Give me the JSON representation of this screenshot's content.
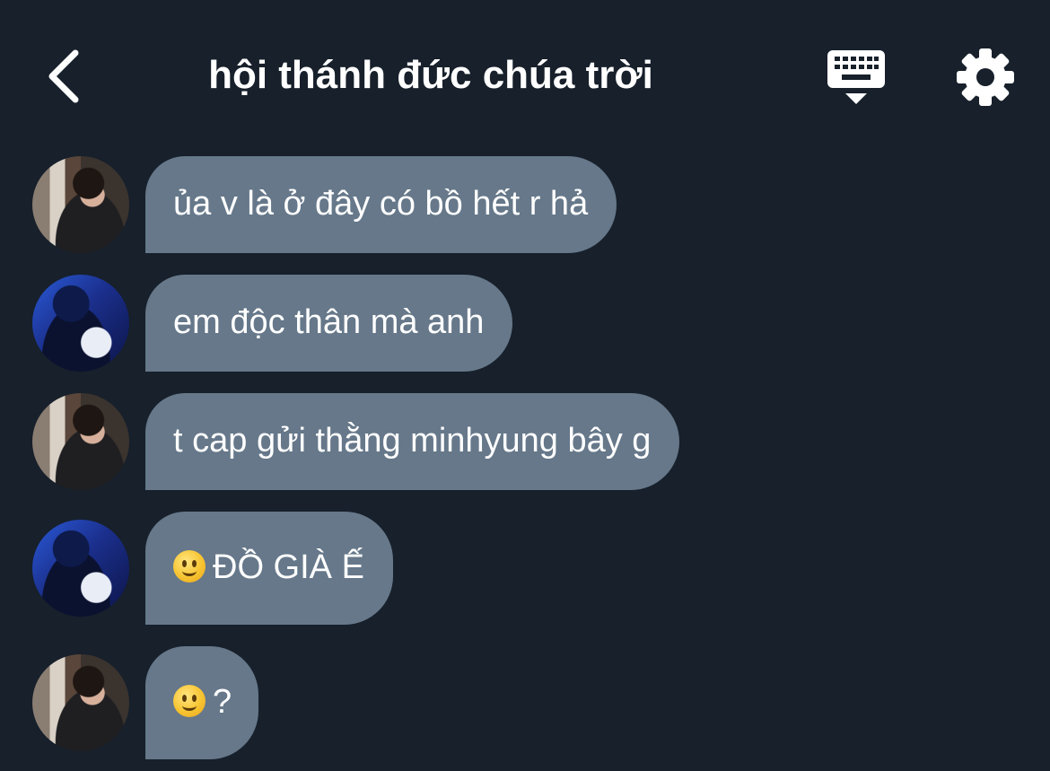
{
  "header": {
    "title": "hội thánh đức chúa trời",
    "back_icon": "chevron-left-icon",
    "keyboard_icon": "keyboard-icon",
    "settings_icon": "gear-icon"
  },
  "colors": {
    "background": "#17202b",
    "bubble": "#66788a",
    "text": "#ffffff"
  },
  "messages": [
    {
      "sender_avatar": "avatar-a",
      "text": "ủa v là ở đây có bồ hết r hả",
      "emoji": ""
    },
    {
      "sender_avatar": "avatar-b",
      "text": "em độc thân mà anh",
      "emoji": ""
    },
    {
      "sender_avatar": "avatar-a",
      "text": "t cap gửi thằng minhyung bây g",
      "emoji": ""
    },
    {
      "sender_avatar": "avatar-b",
      "text": "ĐỒ GIÀ Ế",
      "emoji": "slightly-smiling-face"
    },
    {
      "sender_avatar": "avatar-a",
      "text": "?",
      "emoji": "slightly-smiling-face"
    }
  ]
}
